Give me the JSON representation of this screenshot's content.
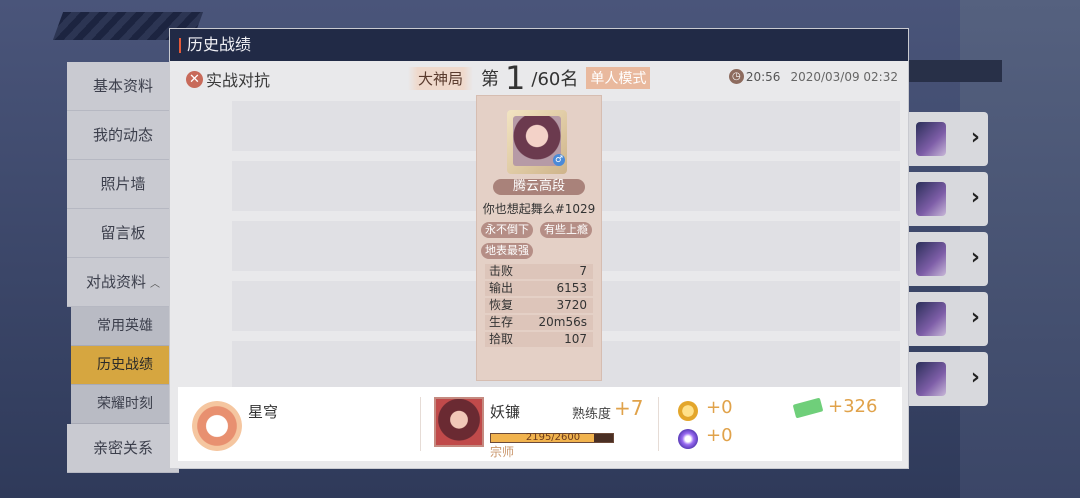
{
  "window": {
    "title": "历史战绩"
  },
  "sidebar": {
    "items": [
      {
        "label": "基本资料"
      },
      {
        "label": "我的动态"
      },
      {
        "label": "照片墙"
      },
      {
        "label": "留言板"
      },
      {
        "label": "对战资料"
      }
    ],
    "sub_items": [
      {
        "label": "常用英雄",
        "active": false
      },
      {
        "label": "历史战绩",
        "active": true
      },
      {
        "label": "荣耀时刻",
        "active": false
      }
    ],
    "bottom_item": {
      "label": "亲密关系"
    }
  },
  "header": {
    "mode": "实战对抗",
    "match_tag": "大神局",
    "rank_prefix": "第",
    "rank": "1",
    "rank_total": "/60名",
    "mode_type": "单人模式",
    "duration": "20:56",
    "datetime": "2020/03/09 02:32"
  },
  "player_card": {
    "rank_title": "腾云高段",
    "name": "你也想起舞么#1029",
    "badges": [
      "永不倒下",
      "有些上瘾",
      "地表最强"
    ],
    "stats": [
      {
        "label": "击败",
        "value": "7"
      },
      {
        "label": "输出",
        "value": "6153"
      },
      {
        "label": "恢复",
        "value": "3720"
      },
      {
        "label": "生存",
        "value": "20m56s"
      },
      {
        "label": "拾取",
        "value": "107"
      }
    ]
  },
  "summary": {
    "emblem_name": "星穹",
    "hero_name": "妖镰",
    "proficiency_label": "熟练度",
    "proficiency_gain": "+7",
    "xp_text": "2195/2600",
    "xp_fraction": 0.844,
    "hero_rank": "宗师",
    "coins": "+0",
    "orbs": "+0",
    "tickets": "+326"
  },
  "colors": {
    "accent_gold": "#e0a24a",
    "active_nav": "#d6a640",
    "title_bar": "#212a46"
  }
}
